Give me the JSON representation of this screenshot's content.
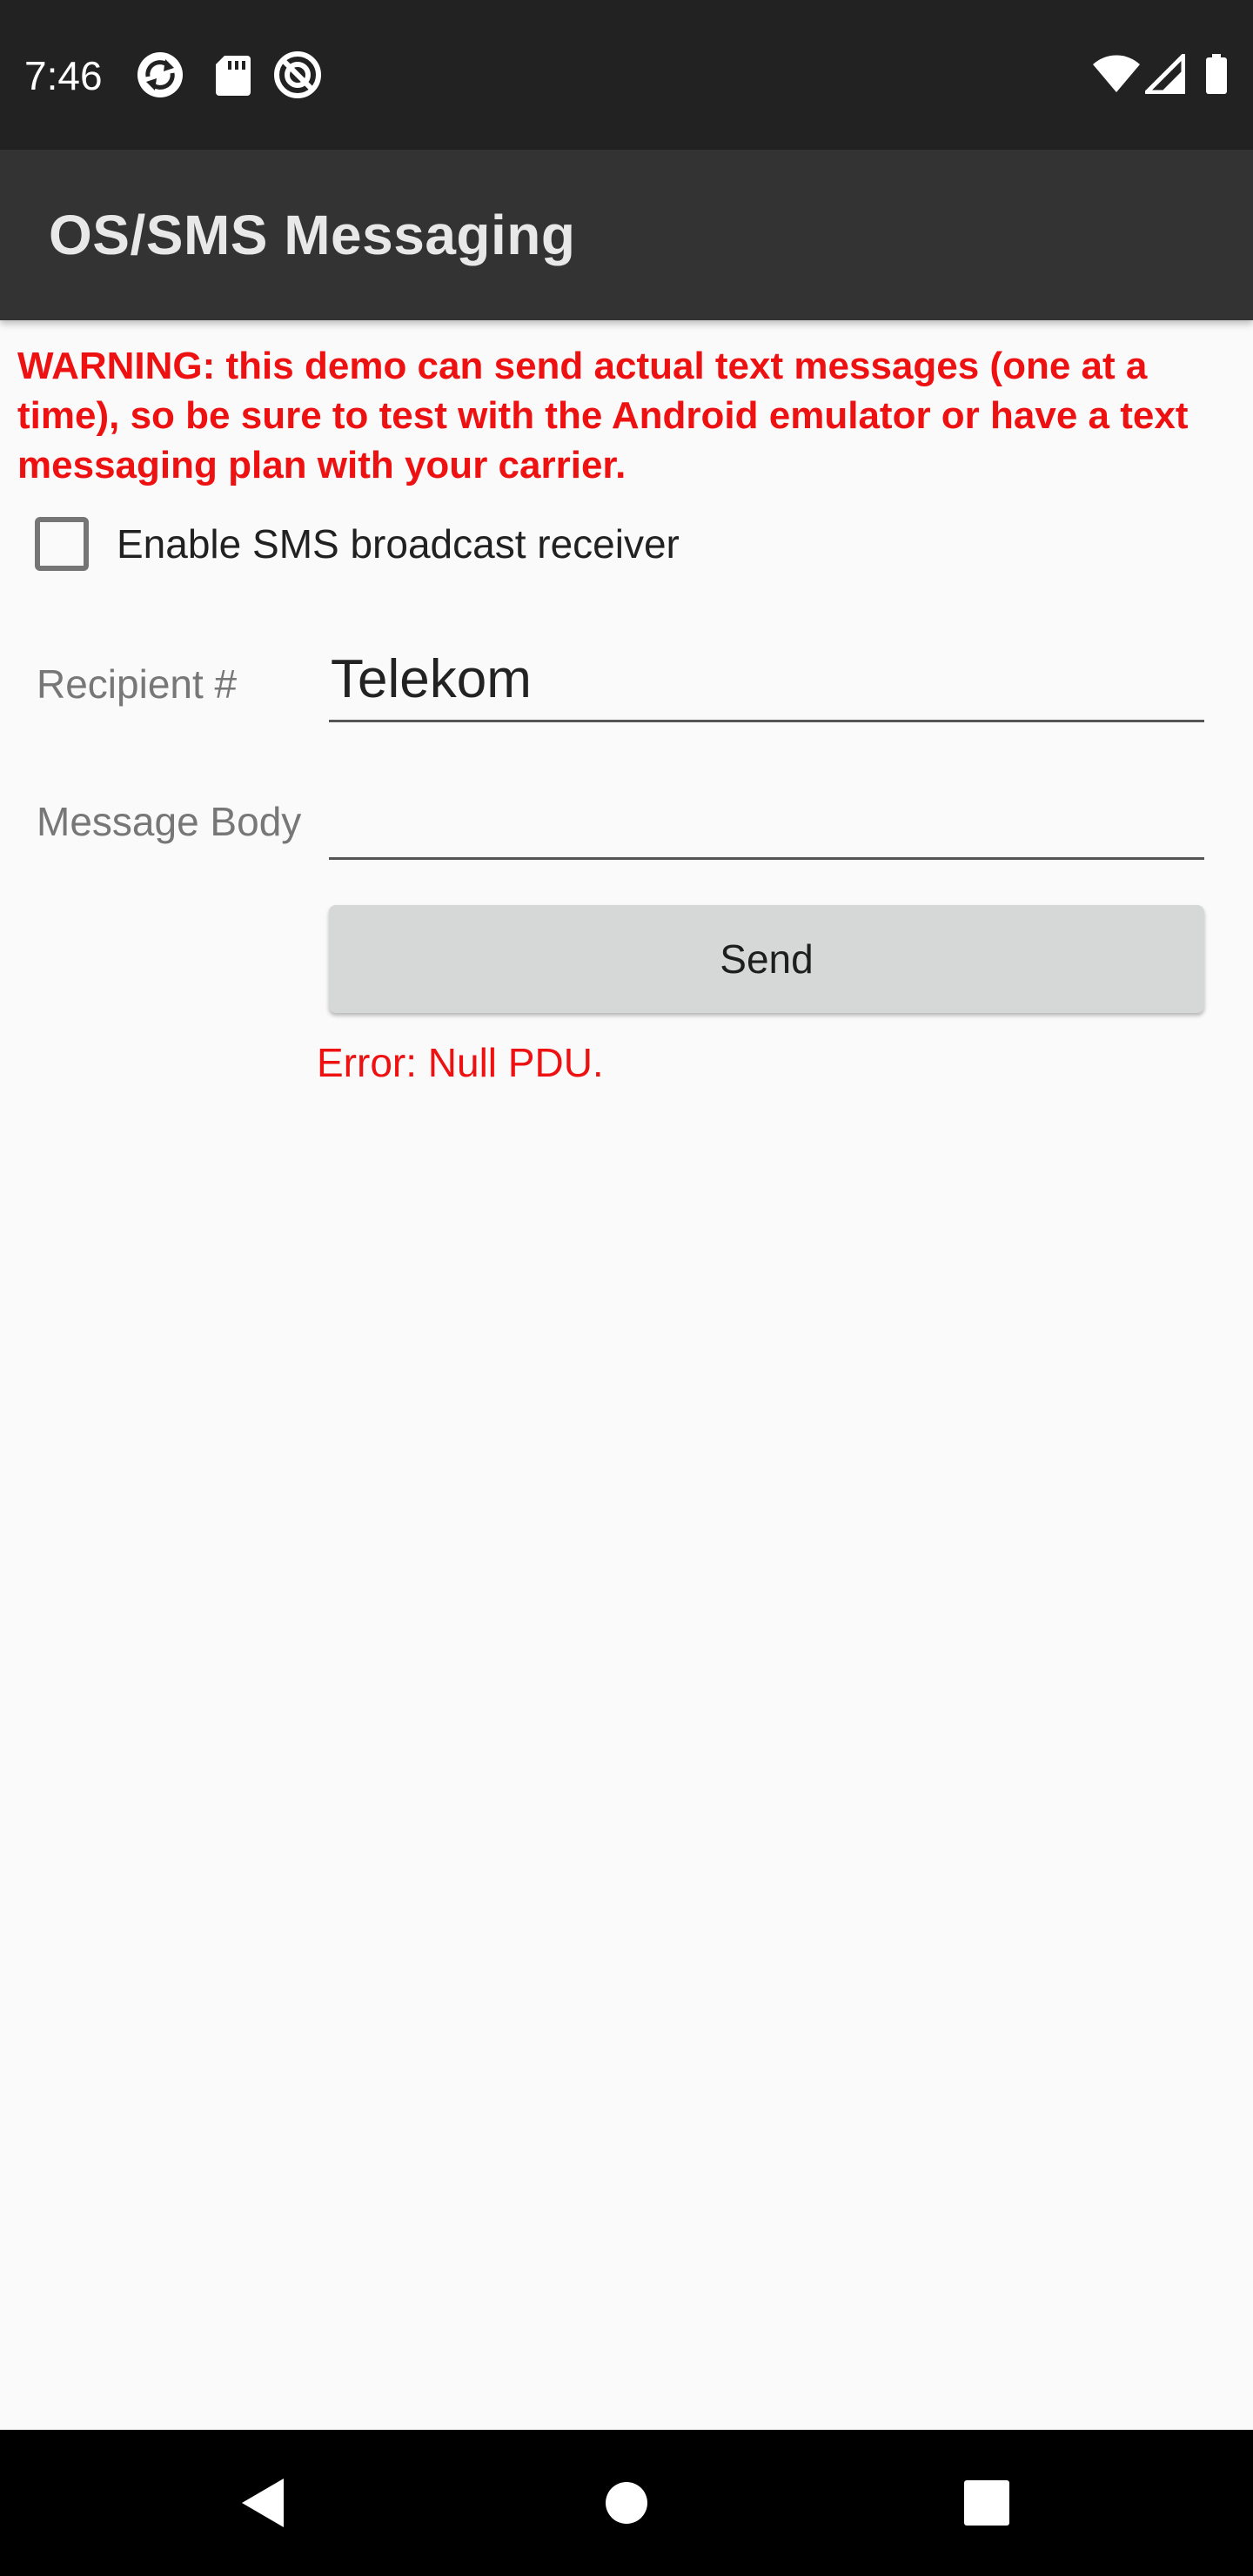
{
  "status_bar": {
    "time": "7:46",
    "left_icons": [
      "sync-icon",
      "sd-card-icon",
      "no-location-icon"
    ],
    "right_icons": [
      "wifi-icon",
      "cell-signal-icon",
      "battery-icon"
    ]
  },
  "app_bar": {
    "title": "OS/SMS Messaging"
  },
  "content": {
    "warning": "WARNING: this demo can send actual text messages (one at a time), so be sure to test with the Android emulator or have a text messaging plan with your carrier.",
    "checkbox_label": "Enable SMS broadcast receiver",
    "checkbox_checked": false,
    "recipient_label": "Recipient #",
    "recipient_value": "Telekom",
    "message_label": "Message Body",
    "message_value": "",
    "send_label": "Send",
    "error": "Error: Null PDU."
  },
  "nav_bar": {
    "buttons": [
      "back-icon",
      "home-icon",
      "recents-icon"
    ]
  },
  "colors": {
    "status_bar_bg": "#222222",
    "app_bar_bg": "#333333",
    "warning_red": "#ee1111",
    "screen_bg": "#fafafa",
    "button_bg": "#d6d7d7"
  }
}
